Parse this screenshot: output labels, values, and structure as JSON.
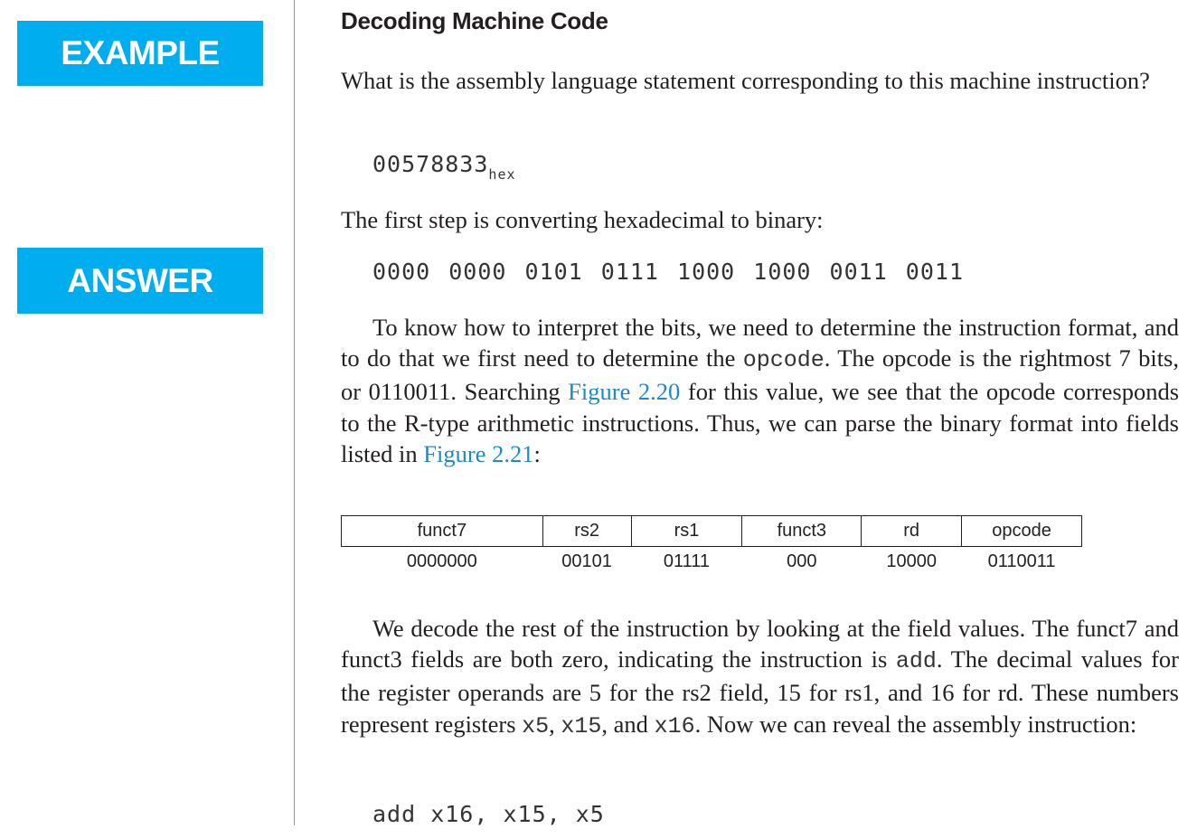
{
  "sidebar": {
    "example_label": "EXAMPLE",
    "answer_label": "ANSWER",
    "accent": "#00aeef"
  },
  "title": "Decoding Machine Code",
  "question": "What is the assembly language statement corresponding to this machine instruction?",
  "hex": {
    "value": "00578833",
    "subscript": "hex"
  },
  "step1": "The first step is converting hexadecimal to binary:",
  "binary": "0000 0000 0101 0111 1000 1000 0011 0011",
  "para1": {
    "a": "To know how to interpret the bits, we need to determine the instruction format, and to do that we first need to determine the ",
    "code1": "opcode",
    "b": ". The opcode is the rightmost 7 bits, or 0110011. Searching ",
    "link1": "Figure 2.20",
    "c": " for this value, we see that the opcode corresponds to the R-type arithmetic instructions. Thus, we can parse the binary format into fields listed in ",
    "link2": "Figure 2.21",
    "d": ":"
  },
  "table": {
    "headers": [
      "funct7",
      "rs2",
      "rs1",
      "funct3",
      "rd",
      "opcode"
    ],
    "values": [
      "0000000",
      "00101",
      "01111",
      "000",
      "10000",
      "0110011"
    ]
  },
  "para2": {
    "a": "We decode the rest of the instruction by looking at the field values. The funct7 and funct3 fields are both zero, indicating the instruction is ",
    "code1": "add",
    "b": ". The decimal values for the register operands are 5 for the rs2 field, 15 for rs1, and 16 for rd. These numbers represent registers ",
    "code2": "x5",
    "c": ", ",
    "code3": "x15",
    "d": ", and ",
    "code4": "x16",
    "e": ". Now we can reveal the assembly instruction:"
  },
  "answer_code": "add x16, x15, x5"
}
